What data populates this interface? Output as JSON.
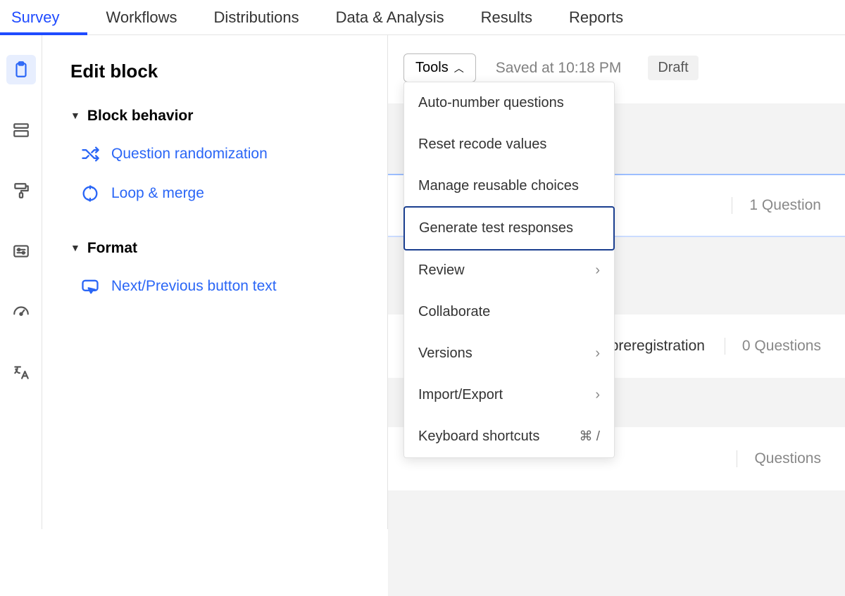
{
  "topnav": {
    "tabs": [
      "Survey",
      "Workflows",
      "Distributions",
      "Data & Analysis",
      "Results",
      "Reports"
    ],
    "active": 0
  },
  "rail": [
    {
      "name": "clipboard",
      "active": true
    },
    {
      "name": "block",
      "active": false
    },
    {
      "name": "paint",
      "active": false
    },
    {
      "name": "slider",
      "active": false
    },
    {
      "name": "dashboard",
      "active": false
    },
    {
      "name": "translate",
      "active": false
    }
  ],
  "sidepanel": {
    "title": "Edit block",
    "sections": [
      {
        "heading": "Block behavior",
        "items": [
          {
            "icon": "shuffle",
            "label": "Question randomization"
          },
          {
            "icon": "loop",
            "label": "Loop & merge"
          }
        ]
      },
      {
        "heading": "Format",
        "items": [
          {
            "icon": "cursor",
            "label": "Next/Previous button text"
          }
        ]
      }
    ]
  },
  "main": {
    "tools_label": "Tools",
    "saved_text": "Saved at 10:18 PM",
    "status": "Draft",
    "blocks": [
      {
        "title": "",
        "meta": "1 Question"
      },
      {
        "title": "preregistration",
        "meta": "0 Questions"
      },
      {
        "title": "",
        "meta": "Questions"
      }
    ]
  },
  "dropdown": {
    "items": [
      {
        "label": "Auto-number questions"
      },
      {
        "label": "Reset recode values"
      },
      {
        "label": "Manage reusable choices"
      },
      {
        "label": "Generate test responses",
        "selected": true
      },
      {
        "label": "Review",
        "submenu": true
      },
      {
        "label": "Collaborate"
      },
      {
        "label": "Versions",
        "submenu": true
      },
      {
        "label": "Import/Export",
        "submenu": true
      },
      {
        "label": "Keyboard shortcuts",
        "shortcut": "⌘ /"
      }
    ]
  }
}
